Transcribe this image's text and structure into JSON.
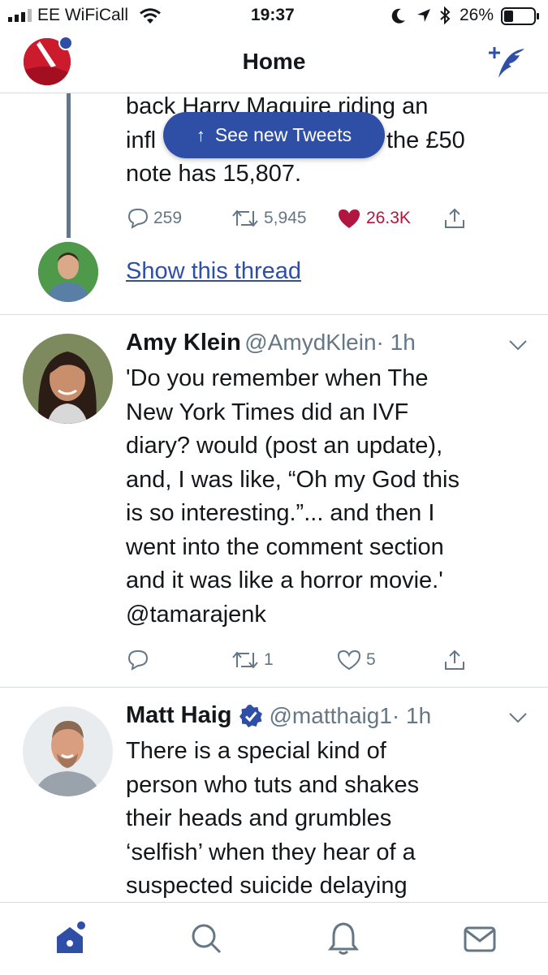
{
  "status_bar": {
    "carrier": "EE WiFiCall",
    "time": "19:37",
    "battery": "26%"
  },
  "nav": {
    "title": "Home"
  },
  "see_new_tweets": {
    "label": "See new Tweets"
  },
  "tweets": [
    {
      "text_lines": [
        "back Harry Maguire riding an",
        "infl",
        "the £50",
        "note has 15,807."
      ],
      "replies": "259",
      "retweets": "5,945",
      "likes": "26.3K",
      "liked": true,
      "show_thread": "Show this thread"
    },
    {
      "name": "Amy Klein",
      "handle": "@AmydKlein",
      "time": "· 1h",
      "text_lines": [
        "'Do you remember when The",
        "New York Times did an IVF",
        "diary?  would (post an update),",
        "and, I was like, “Oh my God this",
        "is so interesting.”... and then I",
        "went into the comment section",
        "and it was like a horror movie.'",
        "@tamarajenk"
      ],
      "replies": "",
      "retweets": "1",
      "likes": "5"
    },
    {
      "name": "Matt Haig",
      "handle": "@matthaig1",
      "time": "· 1h",
      "verified": true,
      "text_lines": [
        "There is a special kind of",
        "person who tuts and shakes",
        "their heads and grumbles",
        "‘selfish’ when they hear of a",
        "suspected suicide delaying"
      ]
    }
  ],
  "colors": {
    "accent": "#2f4ea6",
    "like_red": "#b0163f",
    "link": "#2f4ea6",
    "muted": "#657786"
  },
  "icons": [
    "signal-icon",
    "wifi-icon",
    "moon-icon",
    "location-icon",
    "bluetooth-icon",
    "battery-icon",
    "profile-avatar",
    "compose-tweet-icon",
    "reply-icon",
    "retweet-icon",
    "like-icon",
    "share-icon",
    "chevron-down-icon",
    "verified-badge-icon",
    "home-icon",
    "search-icon",
    "notifications-icon",
    "messages-icon"
  ]
}
